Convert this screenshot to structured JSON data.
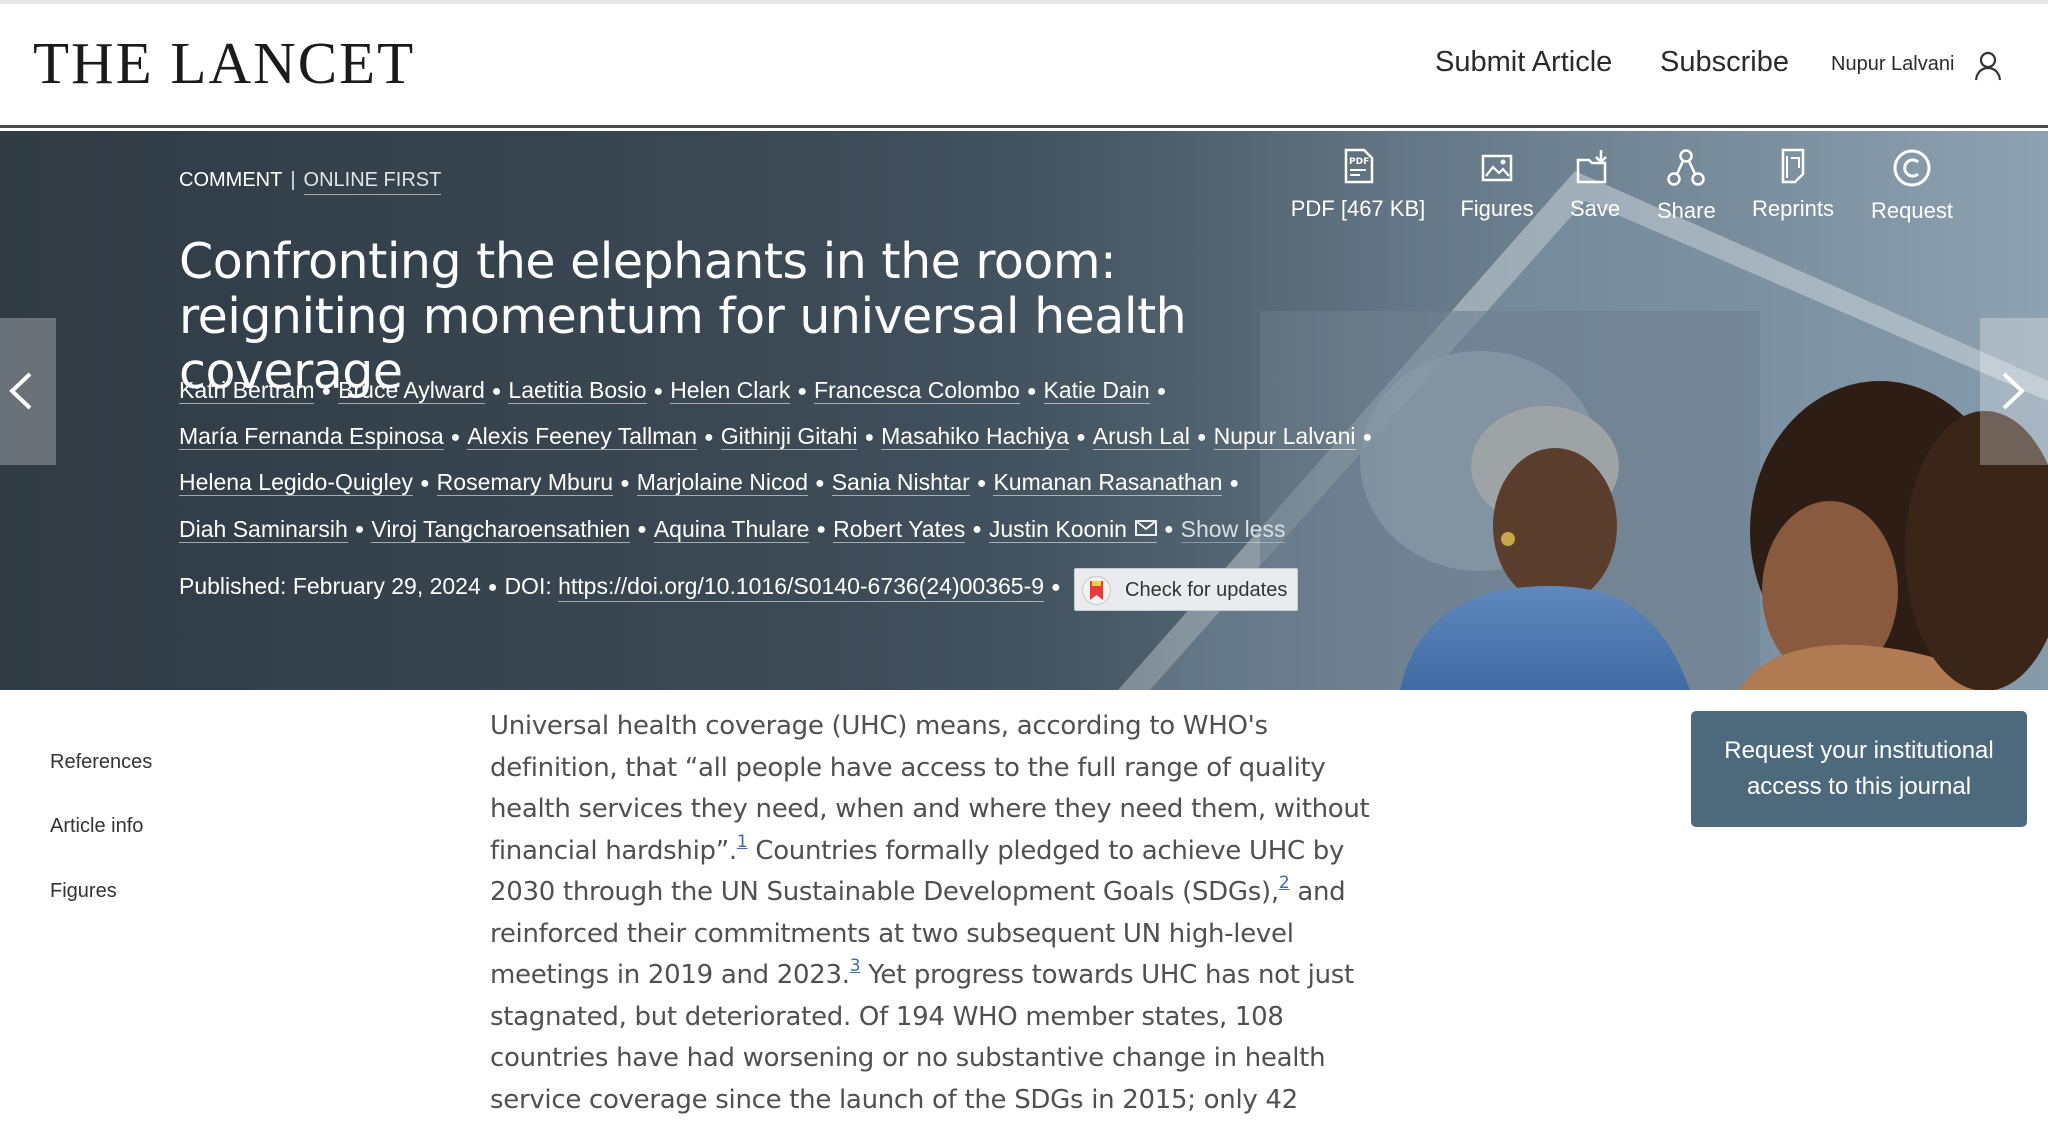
{
  "header": {
    "logo": "THE LANCET",
    "submit_article": "Submit Article",
    "subscribe": "Subscribe",
    "user_name": "Nupur Lalvani"
  },
  "article": {
    "type": "COMMENT",
    "status": "ONLINE FIRST",
    "title": "Confronting the elephants in the room: reigniting momentum for universal health coverage",
    "authors": [
      "Katri Bertram",
      "Bruce Aylward",
      "Laetitia Bosio",
      "Helen Clark",
      "Francesca Colombo",
      "Katie Dain",
      "María Fernanda Espinosa",
      "Alexis Feeney Tallman",
      "Githinji Gitahi",
      "Masahiko Hachiya",
      "Arush Lal",
      "Nupur Lalvani",
      "Helena Legido-Quigley",
      "Rosemary Mburu",
      "Marjolaine Nicod",
      "Sania Nishtar",
      "Kumanan Rasanathan",
      "Diah Saminarsih",
      "Viroj Tangcharoensathien",
      "Aquina Thulare",
      "Robert Yates",
      "Justin Koonin"
    ],
    "show_less": "Show less",
    "published_label": "Published:",
    "published_date": "February 29, 2024",
    "doi_label": "DOI:",
    "doi_url": "https://doi.org/10.1016/S0140-6736(24)00365-9",
    "check_updates": "Check for updates"
  },
  "toolbar": {
    "pdf": "PDF [467 KB]",
    "figures": "Figures",
    "save": "Save",
    "share": "Share",
    "reprints": "Reprints",
    "request": "Request"
  },
  "side_nav": {
    "references": "References",
    "article_info": "Article info",
    "figures": "Figures"
  },
  "body": {
    "lines": [
      "Universal health coverage (UHC) means, according to WHO's",
      "definition, that “all people have access to the full range of quality",
      "health services they need, when and where they need them, without",
      "financial hardship”.",
      "Countries formally pledged to achieve UHC by",
      "2030 through the UN Sustainable Development Goals (SDGs),",
      "and",
      "reinforced their commitments at two subsequent UN high-level",
      "meetings in 2019 and 2023.",
      "Yet progress towards UHC has not just",
      "stagnated, but deteriorated. Of 194 WHO member states, 108",
      "countries have had worsening or no substantive change in health",
      "service coverage since the launch of the SDGs in 2015; only 42"
    ],
    "refs": [
      "1",
      "2",
      "3"
    ]
  },
  "institution_button": {
    "line1": "Request your institutional",
    "line2": "access to this journal"
  }
}
